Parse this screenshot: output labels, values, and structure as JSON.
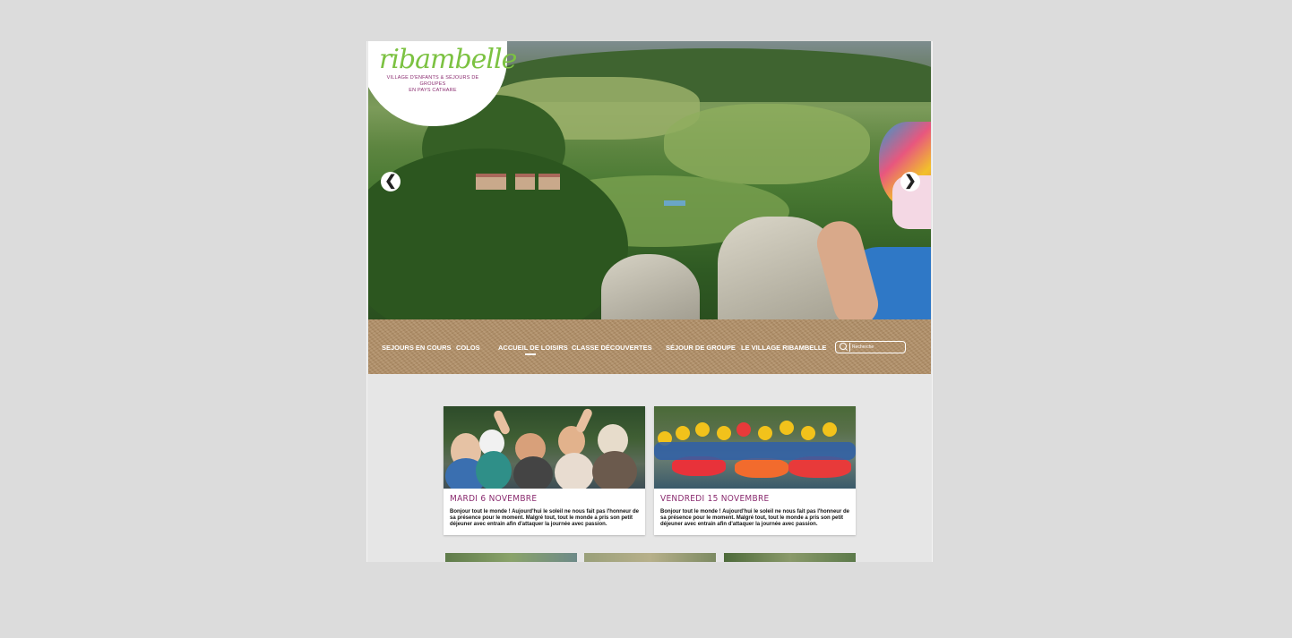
{
  "logo": {
    "name": "ribambelle",
    "tagline_line1": "Village d'enfants & séjours de groupes",
    "tagline_line2": "en pays cathare"
  },
  "hero": {
    "prev_icon": "chevron-left-icon",
    "next_icon": "chevron-right-icon",
    "prev_glyph": "❮",
    "next_glyph": "❯"
  },
  "nav": {
    "items": [
      {
        "label": "SEJOURS EN COURS"
      },
      {
        "label": "COLOS"
      },
      {
        "label": "ACCUEIL DE LOISIRS"
      },
      {
        "label": "CLASSE DÉCOUVERTES"
      },
      {
        "label": "SÉJOUR DE GROUPE"
      },
      {
        "label": "LE VILLAGE RIBAMBELLE"
      }
    ],
    "active_index": 2,
    "search_placeholder": "Recherche"
  },
  "posts": [
    {
      "date": "Mardi 6 Novembre",
      "excerpt": "Bonjour tout le monde ! Aujourd'hui le soleil ne nous fait pas l'honneur de sa présence pour le moment. Malgré tout, tout le monde a pris son petit déjeuner avec entrain afin d'attaquer la journée avec passion."
    },
    {
      "date": "Vendredi 15 Novembre",
      "excerpt": "Bonjour tout le monde ! Aujourd'hui le soleil ne nous fait pas l'honneur de sa présence pour le moment. Malgré tout, tout le monde a pris son petit déjeuner avec entrain afin d'attaquer la journée avec passion."
    }
  ],
  "colors": {
    "brand_green": "#7cc242",
    "brand_purple": "#8a2b6f",
    "nav_kraft": "#b08e66",
    "page_bg": "#e6e6e6"
  }
}
